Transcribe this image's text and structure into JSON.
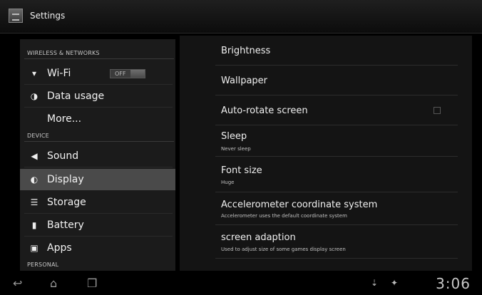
{
  "app": {
    "title": "Settings"
  },
  "sidebar": {
    "sections": [
      "WIRELESS & NETWORKS",
      "DEVICE",
      "PERSONAL"
    ],
    "items": [
      {
        "label": "Wi-Fi",
        "icon": "wifi-icon"
      },
      {
        "label": "Data usage",
        "icon": "data-usage-icon"
      },
      {
        "label": "More..."
      },
      {
        "label": "Sound",
        "icon": "sound-icon"
      },
      {
        "label": "Display",
        "icon": "display-icon",
        "selected": true
      },
      {
        "label": "Storage",
        "icon": "storage-icon"
      },
      {
        "label": "Battery",
        "icon": "battery-icon"
      },
      {
        "label": "Apps",
        "icon": "apps-icon"
      }
    ],
    "wifi_toggle": "OFF"
  },
  "display": {
    "rows": [
      {
        "title": "Brightness"
      },
      {
        "title": "Wallpaper"
      },
      {
        "title": "Auto-rotate screen"
      },
      {
        "title": "Sleep",
        "subtitle": "Never sleep"
      },
      {
        "title": "Font size",
        "subtitle": "Huge"
      },
      {
        "title": "Accelerometer coordinate system",
        "subtitle": "Accelerometer uses the default coordinate system"
      },
      {
        "title": "screen adaption",
        "subtitle": "Used to adjust size of some games display screen"
      }
    ]
  },
  "statusbar": {
    "time": "3:06"
  },
  "colors": {
    "selected_bg": "#4a4a4a",
    "panel_bg": "#141414"
  }
}
